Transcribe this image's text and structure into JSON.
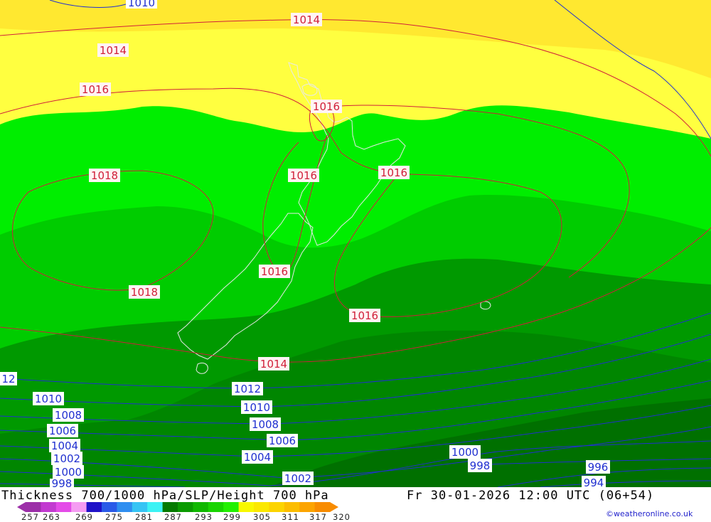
{
  "map": {
    "title": "Thickness 700/1000 hPa/SLP/Height 700 hPa",
    "valid_time": "Fr 30-01-2026 12:00 UTC (06+54)",
    "credit": "©weatheronline.co.uk",
    "isobar_labels_red": [
      "1014",
      "1014",
      "1016",
      "1016",
      "1018",
      "1016",
      "1016",
      "1018",
      "1016",
      "1016",
      "1014"
    ],
    "isobar_labels_blue": [
      "1010",
      "12",
      "1012",
      "1010",
      "1010",
      "1008",
      "1008",
      "1006",
      "1006",
      "1004",
      "1004",
      "1002",
      "1000",
      "998",
      "1002",
      "1000",
      "998",
      "996",
      "994"
    ],
    "scale": {
      "labels": [
        "257",
        "263",
        "269",
        "275",
        "281",
        "287",
        "293",
        "299",
        "305",
        "311",
        "317",
        "320"
      ],
      "colors": [
        "#9c2fa8",
        "#c23ad0",
        "#e44be8",
        "#f59cf2",
        "#1f12c8",
        "#2a5ae8",
        "#2f8ef0",
        "#36c4f4",
        "#3cf2f4",
        "#057a00",
        "#0a9a00",
        "#10b800",
        "#18d400",
        "#22f000",
        "#f8f800",
        "#fbe800",
        "#fcd400",
        "#fcbd00",
        "#fca400",
        "#f88c00"
      ]
    },
    "colors": {
      "yellow_light": "#ffff40",
      "yellow_dark": "#ffe830",
      "green_bright": "#00ee00",
      "green_mid": "#00cc00",
      "green_dark": "#009900",
      "green_darkest": "#007800",
      "isobar_red": "#d0203a",
      "isobar_blue": "#2030d0",
      "coast": "#e8e8e8"
    }
  }
}
